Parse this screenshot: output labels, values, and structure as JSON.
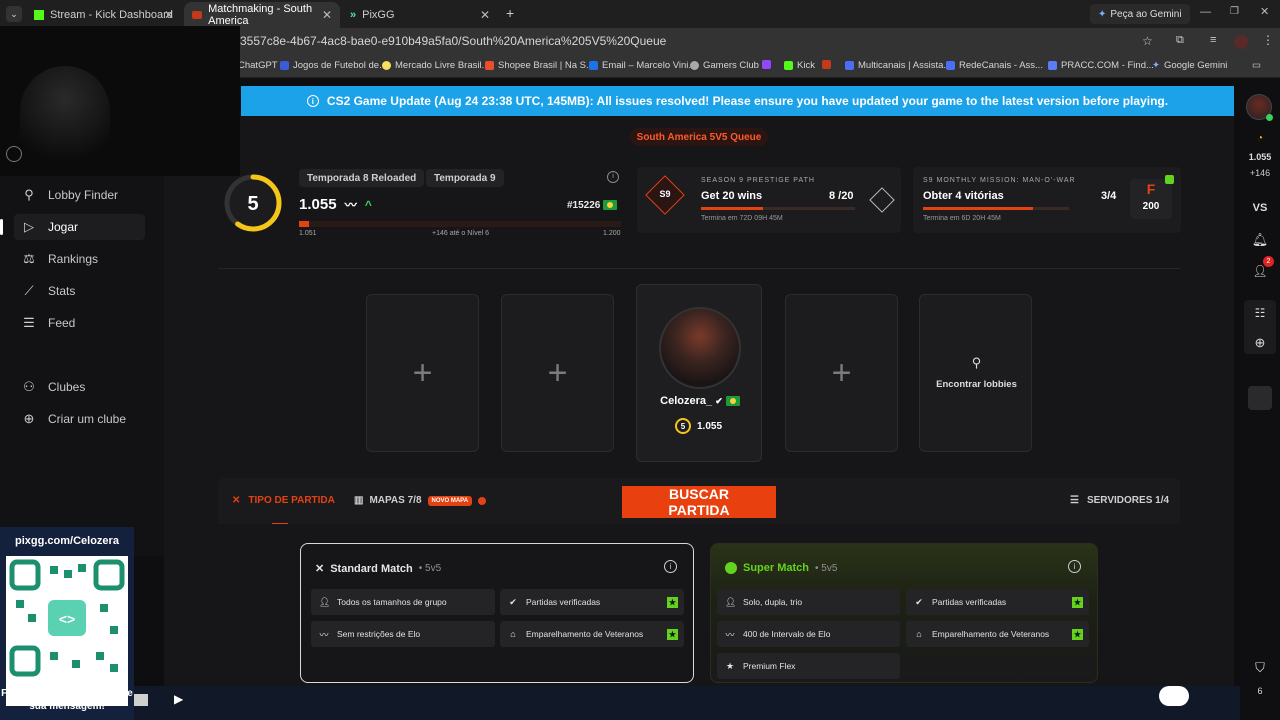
{
  "browser": {
    "tabs": [
      {
        "label": "Stream - Kick Dashboard",
        "icon": "kick-icon"
      },
      {
        "label": "Matchmaking - South America",
        "icon": "gc-icon"
      },
      {
        "label": "PixGG",
        "icon": "pixgg-icon"
      }
    ],
    "new_tab": "+",
    "gemini": "Peça ao Gemini",
    "url": "3557c8e-4b67-4ac8-bae0-e910b49a5fa0/South%20America%205V5%20Queue",
    "bookmarks": [
      "ChatGPT",
      "Jogos de Futebol de...",
      "Mercado Livre Brasil...",
      "Shopee Brasil | Na S...",
      "Email – Marcelo Vini...",
      "Gamers Club",
      "Kick",
      "Multicanais | Assista...",
      "RedeCanais - Ass...",
      "PRACC.COM - Find...",
      "Google Gemini"
    ]
  },
  "banner": {
    "text": "CS2 Game Update (Aug 24 23:38 UTC, 145MB): All issues resolved! Please ensure you have updated your game to the latest version before playing."
  },
  "queue": {
    "label": "South America 5V5 Queue"
  },
  "nav": {
    "items": [
      {
        "label": "Lobby Finder",
        "icon": "search-users-icon"
      },
      {
        "label": "Jogar",
        "icon": "play-icon"
      },
      {
        "label": "Rankings",
        "icon": "rankings-icon"
      },
      {
        "label": "Stats",
        "icon": "stats-icon"
      },
      {
        "label": "Feed",
        "icon": "feed-icon"
      },
      {
        "label": "Clubes",
        "icon": "clubs-icon"
      },
      {
        "label": "Criar um clube",
        "icon": "plus-circle-icon"
      }
    ]
  },
  "rank": {
    "level": "5",
    "level_progress": 0.6,
    "season_a": "Temporada 8 Reloaded",
    "season_b": "Temporada 9",
    "elo": "1.055",
    "position": "#15226",
    "bar_min": "1.051",
    "bar_max": "1.200",
    "next": "+146 até o Nível 6",
    "bar_fraction": 0.03
  },
  "mission1": {
    "label": "SEASON 9 PRESTIGE PATH",
    "badge": "S9",
    "title": "Get 20 wins",
    "progress": "8 /20",
    "fraction": 0.4,
    "footer": "Termina em 72D 09H 45M"
  },
  "mission2": {
    "label": "S9 MONTHLY MISSION: MAN-O'-WAR",
    "title": "Obter 4 vitórias",
    "progress": "3/4",
    "fraction": 0.75,
    "footer": "Termina em 6D 20H 45M",
    "reward": "200"
  },
  "lobby": {
    "player_name": "Celozera_",
    "player_level": "5",
    "player_elo": "1.055",
    "find_label": "Encontrar lobbies"
  },
  "matchbar": {
    "tipo": "TIPO DE PARTIDA",
    "mapas": "MAPAS 7/8",
    "novo": "NOVO MAPA",
    "buscar": "BUSCAR PARTIDA",
    "servidores": "SERVIDORES 1/4"
  },
  "standard": {
    "title": "Standard Match",
    "sub": "• 5v5",
    "features": [
      "Todos os tamanhos de grupo",
      "Partidas verificadas",
      "Sem restrições de Elo",
      "Emparelhamento de Veteranos"
    ]
  },
  "super": {
    "title": "Super Match",
    "sub": "• 5v5",
    "features": [
      "Solo, dupla, trio",
      "Partidas verificadas",
      "400 de Intervalo de Elo",
      "Emparelhamento de Veteranos",
      "Premium Flex"
    ]
  },
  "rightcol": {
    "elo": "1.055",
    "delta": "+146",
    "vs": "VS",
    "notif": "2",
    "bottom": "6"
  },
  "ad": {
    "url": "pixgg.com/Celozera",
    "message": "Fortaleça no donate e envie sua mensagem!"
  },
  "colors": {
    "accent": "#e8410f",
    "banner": "#1ba2e8",
    "super_green": "#62d31f",
    "level_ring": "#f5c518"
  }
}
